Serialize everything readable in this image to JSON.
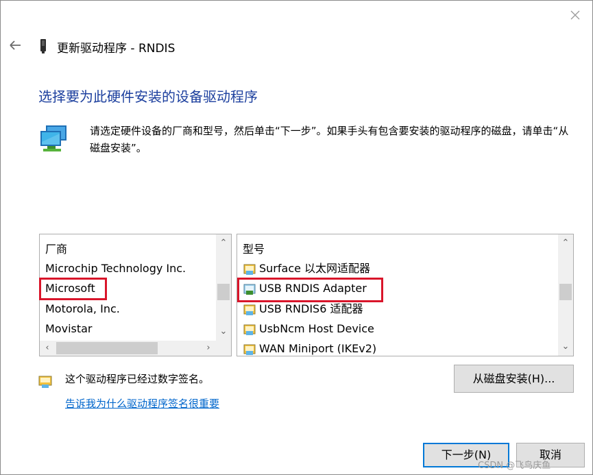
{
  "window": {
    "title": "更新驱动程序 - RNDIS",
    "heading": "选择要为此硬件安装的设备驱动程序",
    "description": "请选定硬件设备的厂商和型号，然后单击“下一步”。如果手头有包含要安装的驱动程序的磁盘，请单击“从磁盘安装”。"
  },
  "icons": {
    "close": "close-icon",
    "back": "back-arrow-icon",
    "device": "device-icon",
    "network": "network-adapter-icon",
    "driver": "driver-icon",
    "signed": "signed-driver-icon"
  },
  "manufacturer_list": {
    "header": "厂商",
    "items": [
      "Microchip Technology Inc.",
      "Microsoft",
      "Motorola, Inc.",
      "Movistar"
    ],
    "selected": "Microsoft"
  },
  "model_list": {
    "header": "型号",
    "items": [
      "Surface 以太网适配器",
      "USB RNDIS Adapter",
      "USB RNDIS6 适配器",
      "UsbNcm Host Device",
      "WAN Miniport (IKEv2)"
    ],
    "selected": "USB RNDIS Adapter"
  },
  "signature": {
    "text": "这个驱动程序已经过数字签名。",
    "link": "告诉我为什么驱动程序签名很重要"
  },
  "buttons": {
    "have_disk": "从磁盘安装(H)...",
    "next": "下一步(N)",
    "cancel": "取消"
  },
  "watermark": "CSDN @飞鸟庆鱼",
  "colors": {
    "heading": "#1c3f9e",
    "link": "#0066cc",
    "highlight_box": "#d9152a",
    "default_button_border": "#0078d7"
  }
}
